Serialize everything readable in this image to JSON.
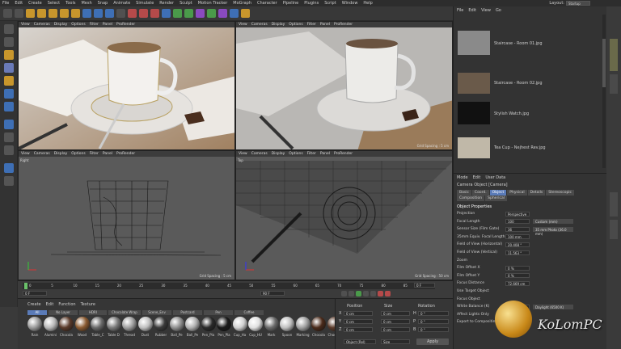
{
  "menubar": {
    "items": [
      "File",
      "Edit",
      "Create",
      "Select",
      "Tools",
      "Mesh",
      "Snap",
      "Animate",
      "Simulate",
      "Render",
      "Sculpt",
      "Motion Tracker",
      "MoGraph",
      "Character",
      "Pipeline",
      "Plugins",
      "Script",
      "Window",
      "Help"
    ],
    "layout_label": "Layout:",
    "layout_value": "Startup"
  },
  "viewport_menu": [
    "View",
    "Cameras",
    "Display",
    "Options",
    "Filter",
    "Panel",
    "ProRender"
  ],
  "viewports": {
    "top_left": {
      "camera_label": ""
    },
    "top_right": {
      "camera_label": "",
      "grid": "Grid Spacing : 5 cm"
    },
    "bottom_left": {
      "camera_label": "Right",
      "grid": "Grid Spacing : 5 cm"
    },
    "bottom_right": {
      "camera_label": "Top",
      "grid": "Grid Spacing : 50 cm"
    }
  },
  "timeline": {
    "start": "0 F",
    "end": "90 F",
    "current": "0 F",
    "ticks": [
      "0",
      "5",
      "10",
      "15",
      "20",
      "25",
      "30",
      "35",
      "40",
      "45",
      "50",
      "55",
      "60",
      "65",
      "70",
      "75",
      "80",
      "85",
      "90"
    ]
  },
  "materials": {
    "menu": [
      "Create",
      "Edit",
      "Function",
      "Texture"
    ],
    "tabs": [
      "All",
      "No Layer",
      "HDRI",
      "Chocolate Wrap",
      "Scene_Env",
      "Postcard",
      "Pen",
      "Coffee"
    ],
    "items": [
      {
        "name": "Rain",
        "color": "#9a9a9a"
      },
      {
        "name": "Alumini",
        "color": "#b8b8b8"
      },
      {
        "name": "Chocola",
        "color": "#5a3a2a"
      },
      {
        "name": "Wood",
        "color": "#8a5a30"
      },
      {
        "name": "Table_C",
        "color": "#6a6a6a"
      },
      {
        "name": "Table D",
        "color": "#7a7a7a"
      },
      {
        "name": "Thread",
        "color": "#a0a0a0"
      },
      {
        "name": "Dust",
        "color": "#c0c0c0"
      },
      {
        "name": "Rubber",
        "color": "#3a3a3a"
      },
      {
        "name": "Ball_Pe",
        "color": "#909090"
      },
      {
        "name": "Ball_Pe",
        "color": "#b0b0b0"
      },
      {
        "name": "Pen_Pla",
        "color": "#2a2a2a"
      },
      {
        "name": "Pen_Pla",
        "color": "#1a1a1a"
      },
      {
        "name": "Cup_Ha",
        "color": "#d0d0d0"
      },
      {
        "name": "Cup_HU",
        "color": "#e0e0e0"
      },
      {
        "name": "Mark",
        "color": "#6a6a6a"
      },
      {
        "name": "Spoon",
        "color": "#c0c0c0"
      },
      {
        "name": "Marking",
        "color": "#a0a0a0"
      },
      {
        "name": "Chocola",
        "color": "#4a2a1a"
      },
      {
        "name": "Chocola",
        "color": "#5a3a2a"
      }
    ]
  },
  "coordinates": {
    "headers": [
      "Position",
      "Size",
      "Rotation"
    ],
    "rows": [
      {
        "axis": "X",
        "pos": "0 cm",
        "size": "0 cm",
        "rot_axis": "H",
        "rot": "0 °"
      },
      {
        "axis": "Y",
        "pos": "0 cm",
        "size": "0 cm",
        "rot_axis": "P",
        "rot": "0 °"
      },
      {
        "axis": "Z",
        "pos": "0 cm",
        "size": "0 cm",
        "rot_axis": "B",
        "rot": "0 °"
      }
    ],
    "mode": "Object (Rel)",
    "size_mode": "Size",
    "apply": "Apply"
  },
  "object_manager": {
    "menu": [
      "File",
      "Edit",
      "View",
      "Go"
    ],
    "items": [
      {
        "name": "Staircase - Room 01.jpg"
      },
      {
        "name": "Staircase - Room 02.jpg"
      },
      {
        "name": "Stylish Watch.jpg"
      },
      {
        "name": "Tea Cup - Nejhest Rev.jpg"
      }
    ]
  },
  "attributes": {
    "menu": [
      "Mode",
      "Edit",
      "User Data"
    ],
    "title": "Camera Object [Camera]",
    "tabs": [
      "Basic",
      "Coord.",
      "Object",
      "Physical",
      "Details",
      "Stereoscopic",
      "Composition",
      "Spherical"
    ],
    "active_tab": "Object",
    "section": "Object Properties",
    "props": [
      {
        "label": "Projection",
        "value": "Perspective"
      },
      {
        "label": "Focal Length",
        "value": "100",
        "extra": "Custom (mm)"
      },
      {
        "label": "Sensor Size (Film Gate)",
        "value": "36",
        "extra": "35 mm Photo (36.0 mm)"
      },
      {
        "label": "35mm Equiv. Focal Length:",
        "value": "100 mm"
      },
      {
        "label": "Field of View (Horizontal)",
        "value": "20.408 °"
      },
      {
        "label": "Field of View (Vertical)",
        "value": "11.563 °"
      },
      {
        "label": "Zoom",
        "value": ""
      },
      {
        "label": "Film Offset X",
        "value": "0 %"
      },
      {
        "label": "Film Offset Y",
        "value": "0 %"
      },
      {
        "label": "Focus Distance",
        "value": "72.669 cm"
      },
      {
        "label": "Use Target Object",
        "value": ""
      },
      {
        "label": "Focus Object",
        "value": ""
      },
      {
        "label": "White Balance (K)",
        "value": "6500",
        "extra": "Daylight (6500 K)"
      },
      {
        "label": "Affect Lights Only",
        "value": ""
      },
      {
        "label": "Export to Compositing",
        "value": ""
      }
    ]
  },
  "watermark": "KoLomPC"
}
